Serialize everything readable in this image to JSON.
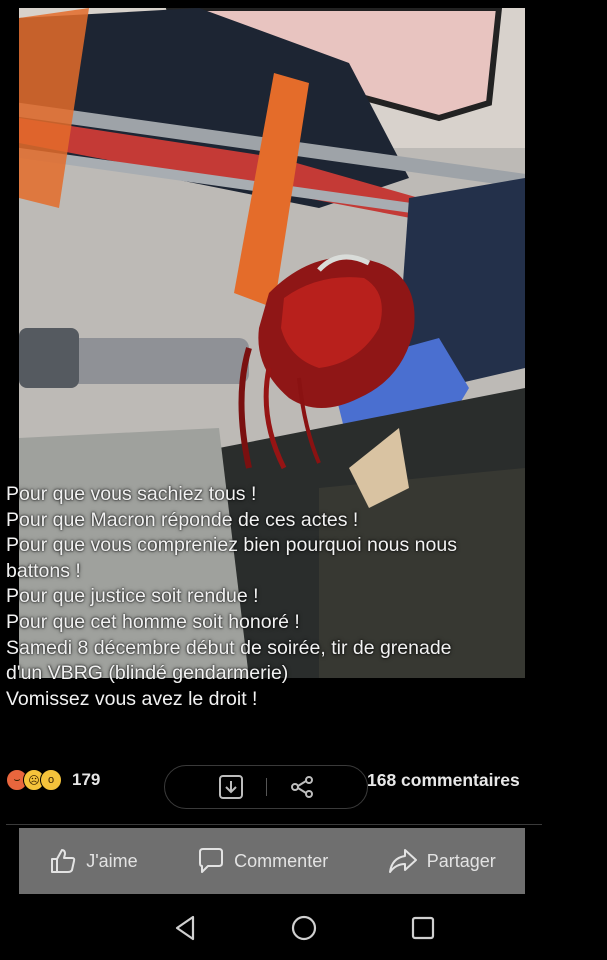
{
  "post": {
    "lines": [
      "Pour que vous sachiez tous !",
      "Pour que Macron réponde de ces actes !",
      "Pour que vous compreniez bien pourquoi nous nous",
      "battons !",
      "Pour que justice soit rendue !",
      "Pour que cet homme soit honoré !",
      "Samedi 8 décembre début de soirée, tir de grenade",
      "d'un VBRG (blindé gendarmerie)",
      "Vomissez vous avez le droit !"
    ]
  },
  "reactions": {
    "icons": [
      "angry-icon",
      "sad-icon",
      "wow-icon"
    ],
    "count": "179"
  },
  "comments_label": "168 commentaires",
  "actions": {
    "like": "J'aime",
    "comment": "Commenter",
    "share": "Partager"
  },
  "colors": {
    "background": "#000000",
    "action_bar": "#6f6f6f",
    "reaction_angry": "#e8663d",
    "reaction_yellow": "#f5c33b"
  }
}
